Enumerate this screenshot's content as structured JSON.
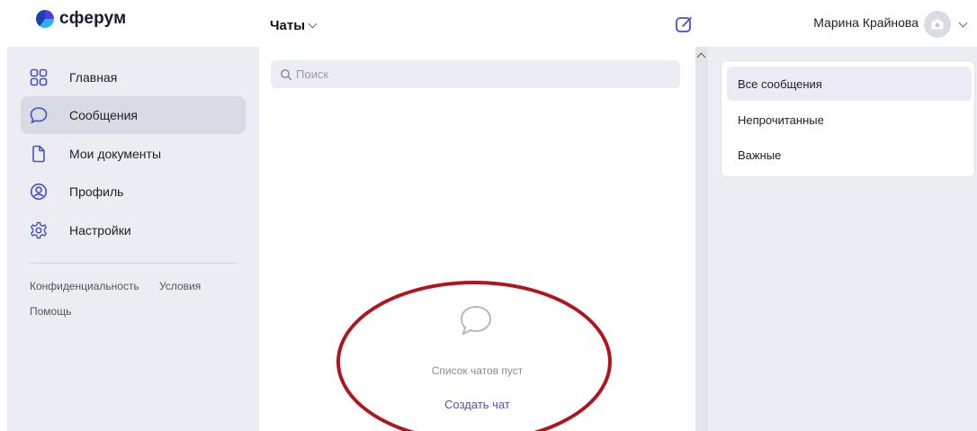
{
  "header": {
    "logo_text": "сферум",
    "chats_title": "Чаты",
    "user_name": "Марина Крайнова"
  },
  "sidebar": {
    "items": [
      {
        "label": "Главная",
        "icon": "apps-grid-icon",
        "active": false
      },
      {
        "label": "Сообщения",
        "icon": "chat-bubble-icon",
        "active": true
      },
      {
        "label": "Мои документы",
        "icon": "document-icon",
        "active": false
      },
      {
        "label": "Профиль",
        "icon": "profile-icon",
        "active": false
      },
      {
        "label": "Настройки",
        "icon": "gear-icon",
        "active": false
      }
    ],
    "footer": {
      "privacy": "Конфиденциальность",
      "terms": "Условия",
      "help": "Помощь"
    }
  },
  "middle": {
    "search_placeholder": "Поиск",
    "empty_text": "Список чатов пуст",
    "create_chat": "Создать чат"
  },
  "filters": {
    "items": [
      {
        "label": "Все сообщения",
        "active": true
      },
      {
        "label": "Непрочитанные",
        "active": false
      },
      {
        "label": "Важные",
        "active": false
      }
    ]
  },
  "colors": {
    "accent": "#4a4fc8",
    "sidebar_bg": "#ebedf2",
    "active_bg": "#d8dae4",
    "highlight_oval": "#b0141e"
  }
}
